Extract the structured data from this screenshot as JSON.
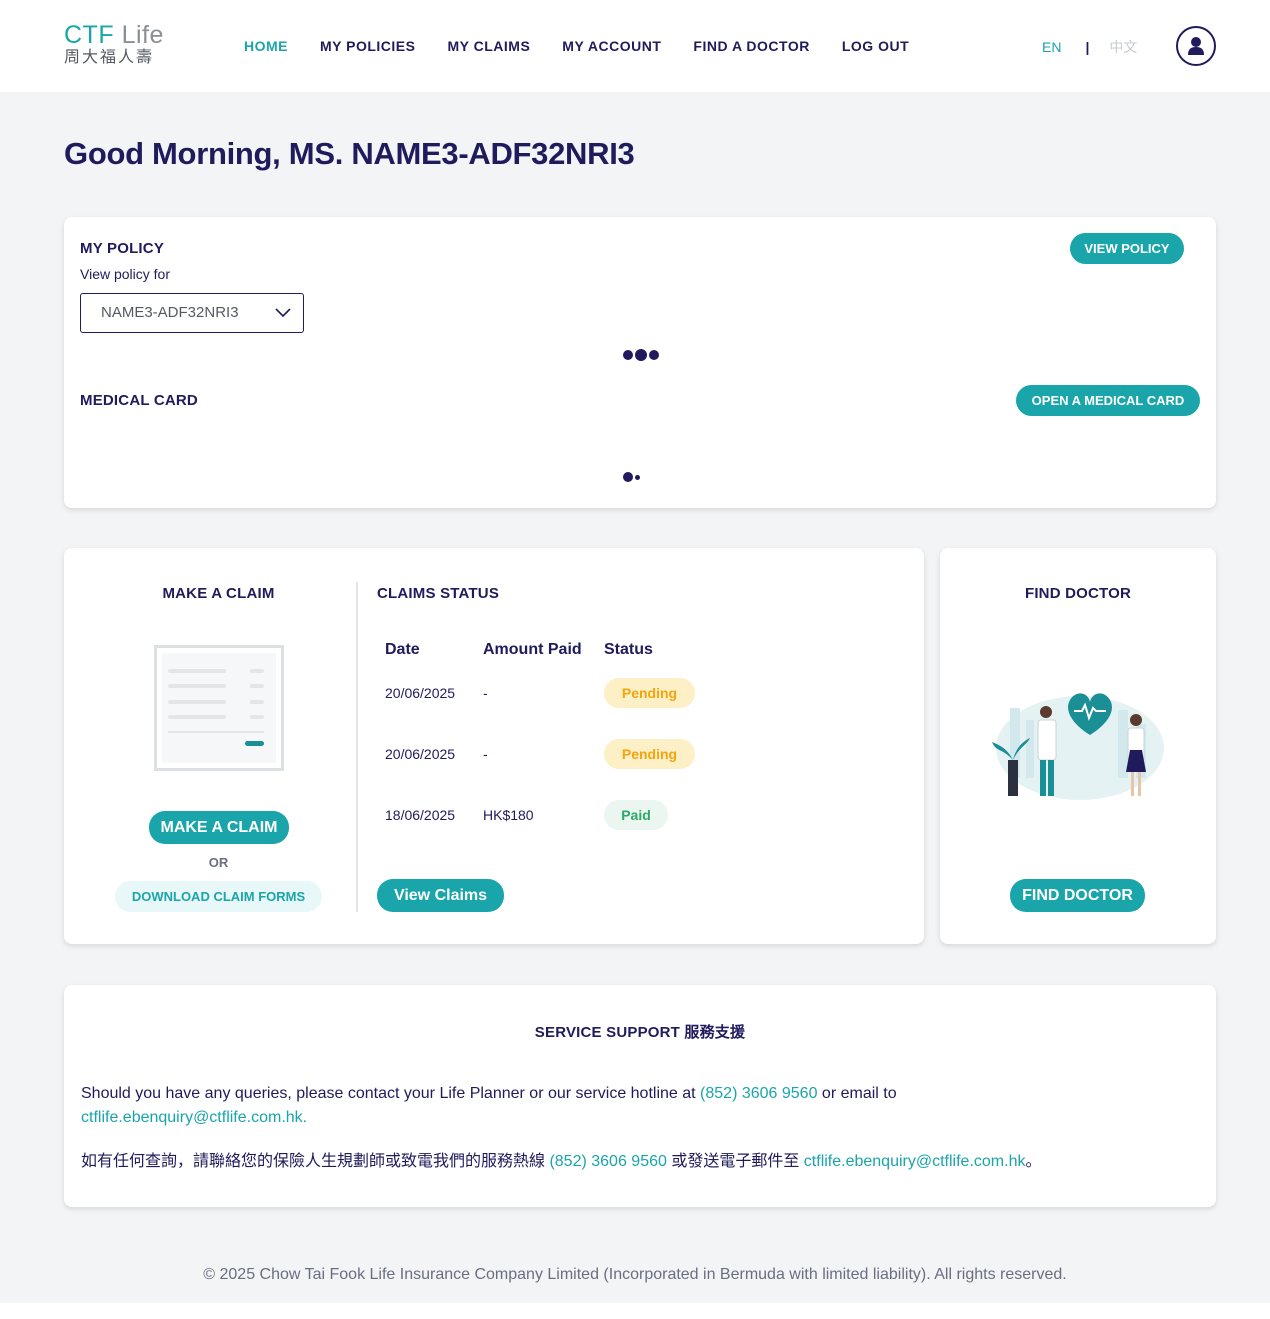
{
  "brand": {
    "logo_en_main": "CTF",
    "logo_en_light": "Life",
    "logo_zh": "周大福人壽"
  },
  "nav": [
    {
      "label": "HOME",
      "active": true
    },
    {
      "label": "MY POLICIES"
    },
    {
      "label": "MY CLAIMS"
    },
    {
      "label": "MY ACCOUNT"
    },
    {
      "label": "FIND A DOCTOR"
    },
    {
      "label": "LOG OUT"
    }
  ],
  "lang": {
    "en": "EN",
    "sep": "|",
    "zh": "中文"
  },
  "greeting": "Good Morning, MS. NAME3-ADF32NRI3",
  "policy": {
    "title": "MY POLICY",
    "subtitle": "View policy for",
    "selected": "NAME3-ADF32NRI3",
    "view_button": "VIEW POLICY"
  },
  "medical_card": {
    "title": "MEDICAL CARD",
    "open_button": "OPEN A MEDICAL CARD"
  },
  "make_claim": {
    "title": "MAKE A CLAIM",
    "button": "MAKE A CLAIM",
    "or": "OR",
    "download": "DOWNLOAD CLAIM FORMS"
  },
  "claims_status": {
    "title": "CLAIMS STATUS",
    "headers": {
      "date": "Date",
      "amount": "Amount Paid",
      "status": "Status"
    },
    "rows": [
      {
        "date": "20/06/2025",
        "amount": "-",
        "status": "Pending"
      },
      {
        "date": "20/06/2025",
        "amount": "-",
        "status": "Pending"
      },
      {
        "date": "18/06/2025",
        "amount": "HK$180",
        "status": "Paid"
      }
    ],
    "view_button": "View Claims"
  },
  "find_doctor": {
    "title": "FIND DOCTOR",
    "button": "FIND DOCTOR"
  },
  "support": {
    "title": "SERVICE SUPPORT 服務支援",
    "en_prefix": "Should you have any queries, please contact your Life Planner or our service hotline at ",
    "en_phone": "(852) 3606 9560",
    "en_mid": " or email to",
    "en_email": "ctflife.ebenquiry@ctflife.com.hk.",
    "zh_prefix": "如有任何查詢，請聯絡您的保險人生規劃師或致電我們的服務熱線 ",
    "zh_phone": "(852) 3606 9560",
    "zh_mid": " 或發送電子郵件至 ",
    "zh_email": "ctflife.ebenquiry@ctflife.com.hk",
    "zh_end": "。"
  },
  "footer": "© 2025 Chow Tai Fook Life Insurance Company Limited (Incorporated in Bermuda with limited liability). All rights reserved.",
  "colors": {
    "navy": "#1f1b5c",
    "teal": "#1aa5ab",
    "pending": "#f2a50c",
    "paid": "#2ea86a"
  }
}
